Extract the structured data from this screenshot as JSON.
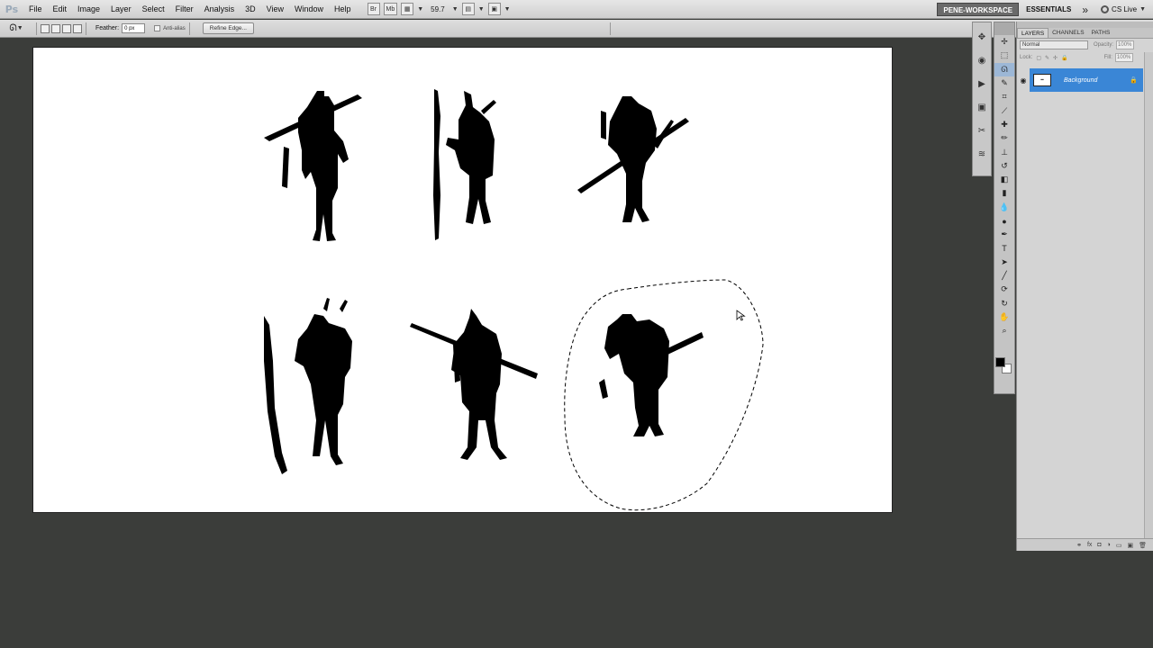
{
  "app": {
    "logo": "Ps"
  },
  "menu": [
    "File",
    "Edit",
    "Image",
    "Layer",
    "Select",
    "Filter",
    "Analysis",
    "3D",
    "View",
    "Window",
    "Help"
  ],
  "menubar_tools": {
    "br": "Br",
    "mb": "Mb",
    "zoom": "59.7"
  },
  "workspace": {
    "current": "PENE-WORKSPACE",
    "essentials": "ESSENTIALS",
    "more": "»",
    "cslive": "CS Live"
  },
  "options": {
    "tool_icon": "lasso-icon",
    "feather_label": "Feather:",
    "feather_value": "0 px",
    "antialias_label": "Anti-alias",
    "refine_edge": "Refine Edge..."
  },
  "toolbox_tools": [
    "move",
    "marquee",
    "lasso",
    "quick-select",
    "crop",
    "eyedropper",
    "healing",
    "brush",
    "clone-stamp",
    "history-brush",
    "eraser",
    "gradient",
    "blur",
    "dodge",
    "pen",
    "type",
    "path-select",
    "line",
    "3d-rotate",
    "3d-orbit",
    "hand",
    "zoom"
  ],
  "layers_panel": {
    "tabs": [
      "LAYERS",
      "CHANNELS",
      "PATHS"
    ],
    "blend_mode": "Normal",
    "opacity_label": "Opacity:",
    "opacity_value": "100%",
    "lock_label": "Lock:",
    "fill_label": "Fill:",
    "fill_value": "100%",
    "layer_name": "Background"
  },
  "colors": {
    "selection_highlight": "#3a86d6",
    "canvas_bg": "#ffffff",
    "workspace_bg": "#3b3d3a",
    "foreground": "#000000"
  }
}
